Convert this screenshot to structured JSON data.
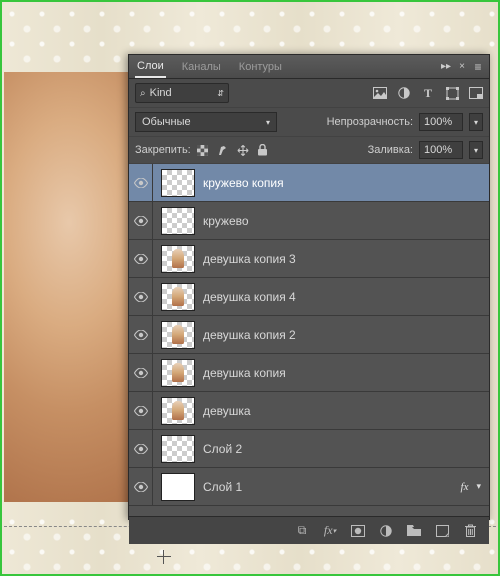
{
  "tabs": {
    "layers": "Слои",
    "channels": "Каналы",
    "paths": "Контуры"
  },
  "kind": {
    "label": "Kind"
  },
  "blend": {
    "mode": "Обычные"
  },
  "opacity": {
    "label": "Непрозрачность:",
    "value": "100%"
  },
  "lock": {
    "label": "Закрепить:"
  },
  "fill": {
    "label": "Заливка:",
    "value": "100%"
  },
  "layers_list": [
    {
      "name": "кружево копия",
      "selected": true,
      "thumb": "checker",
      "mini": false,
      "fx": false
    },
    {
      "name": "кружево",
      "selected": false,
      "thumb": "checker",
      "mini": false,
      "fx": false
    },
    {
      "name": "девушка копия 3",
      "selected": false,
      "thumb": "checker",
      "mini": true,
      "fx": false
    },
    {
      "name": "девушка копия 4",
      "selected": false,
      "thumb": "checker",
      "mini": true,
      "fx": false
    },
    {
      "name": "девушка копия 2",
      "selected": false,
      "thumb": "checker",
      "mini": true,
      "fx": false
    },
    {
      "name": "девушка копия",
      "selected": false,
      "thumb": "checker",
      "mini": true,
      "fx": false
    },
    {
      "name": "девушка",
      "selected": false,
      "thumb": "checker",
      "mini": true,
      "fx": false
    },
    {
      "name": "Слой 2",
      "selected": false,
      "thumb": "checker",
      "mini": false,
      "fx": false
    },
    {
      "name": "Слой 1",
      "selected": false,
      "thumb": "solid",
      "mini": false,
      "fx": true
    }
  ],
  "icons": {
    "search": "⌕",
    "dropdown": "▾",
    "image": "img",
    "adjust": "◐",
    "type": "T",
    "path": "path",
    "smart": "▭",
    "lock_pixels": "▦",
    "lock_brush": "brush",
    "lock_move": "✥",
    "lock_all": "🔒",
    "eye": "eye",
    "link": "⧉",
    "fx": "fx.",
    "mask": "◑",
    "newfill": "◐",
    "group": "▅",
    "newlayer": "▫",
    "trash": "🗑",
    "collapse": "▸▸",
    "close": "×",
    "menu": "≡"
  }
}
